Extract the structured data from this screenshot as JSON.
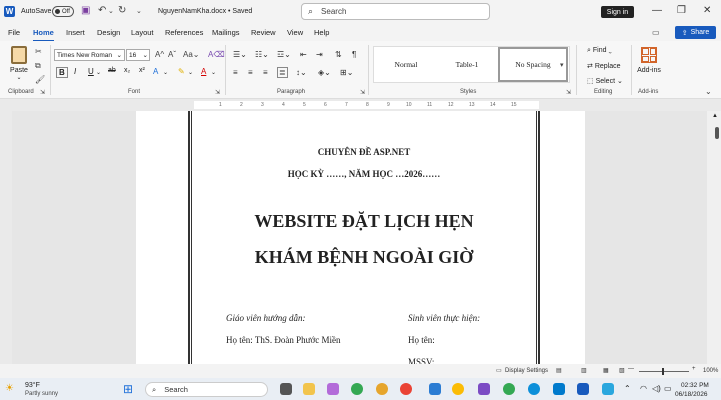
{
  "titlebar": {
    "autosave_label": "AutoSave",
    "autosave_state": "Off",
    "doc_name": "NguyenNamKha.docx • Saved",
    "search_placeholder": "Search",
    "sign_in": "Sign in"
  },
  "menu": {
    "tabs": [
      "File",
      "Home",
      "Insert",
      "Design",
      "Layout",
      "References",
      "Mailings",
      "Review",
      "View",
      "Help"
    ],
    "active": "Home",
    "share": "Share"
  },
  "ribbon": {
    "clipboard": {
      "paste": "Paste",
      "label": "Clipboard"
    },
    "font": {
      "name": "Times New Roman",
      "size": "16",
      "label": "Font"
    },
    "paragraph": {
      "label": "Paragraph"
    },
    "styles": {
      "items": [
        "Normal",
        "Table-1",
        "No Spacing"
      ],
      "selected": "No Spacing",
      "label": "Styles"
    },
    "editing": {
      "items": [
        "Find",
        "Replace",
        "Select"
      ],
      "label": "Editing"
    },
    "addins": {
      "button": "Add-ins",
      "label": "Add-ins"
    }
  },
  "ruler": {
    "numbers": [
      "1",
      "2",
      "3",
      "4",
      "5",
      "6",
      "7",
      "8",
      "9",
      "10",
      "11",
      "12",
      "13",
      "14",
      "15"
    ]
  },
  "document": {
    "topic": "CHUYÊN ĐỀ ASP.NET",
    "semester": "HỌC KỲ ……, NĂM HỌC …2026……",
    "title_line1": "WEBSITE ĐẶT LỊCH HẸN",
    "title_line2": "KHÁM BỆNH NGOÀI GIỜ",
    "advisor_heading": "Giáo viên hướng dẫn:",
    "advisor_name": "Họ tên: ThS. Đoàn Phước Miền",
    "student_heading": "Sinh viên thực hiện:",
    "student_name": "Họ tên:",
    "student_id": "MSSV:"
  },
  "statusbar": {
    "display_settings": "Display Settings",
    "zoom": "100%"
  },
  "taskbar": {
    "weather_temp": "93°F",
    "weather_desc": "Partly sunny",
    "search": "Search",
    "time": "02:32 PM",
    "date": "06/18/2026"
  },
  "colors": {
    "accent": "#185abd",
    "addins": "#d2652b"
  }
}
